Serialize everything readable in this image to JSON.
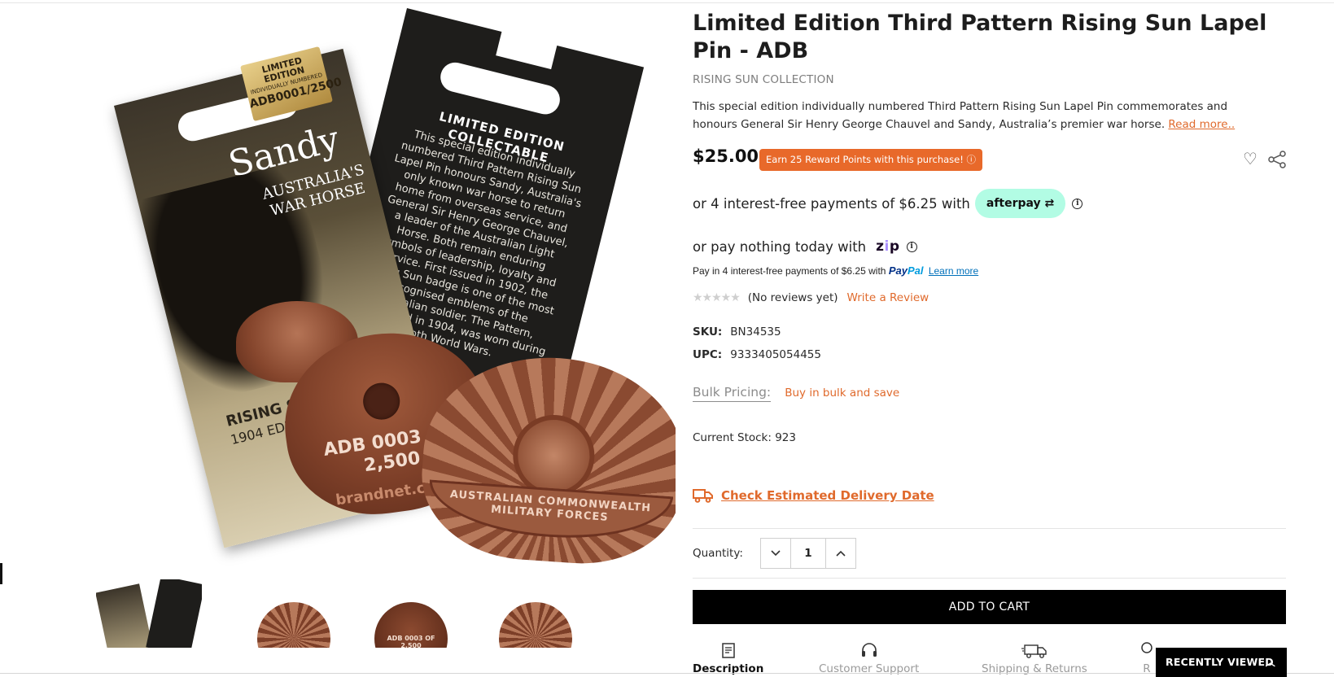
{
  "product": {
    "title": "Limited Edition Third Pattern Rising Sun Lapel Pin - ADB",
    "collection": "RISING SUN COLLECTION",
    "description": "This special edition individually numbered Third Pattern Rising Sun Lapel Pin commemorates and honours General Sir Henry George Chauvel and Sandy, Australia’s premier war horse.",
    "read_more": "Read more..",
    "price": "$25.00",
    "reward_badge": "Earn 25 Reward Points with this purchase! ⓘ"
  },
  "image": {
    "gold_tag": {
      "line1": "LIMITED EDITION",
      "line2": "INDIVIDUALLY NUMBERED",
      "line3": "ADB0001/2500"
    },
    "front_card": {
      "name": "Sandy",
      "subtitle": "AUSTRALIA'S WAR HORSE",
      "series": "RISING SU",
      "edition": "1904 EDITIO"
    },
    "back_card": {
      "heading": "LIMITED EDITION COLLECTABLE",
      "text": "This special edition individually numbered Third Pattern Rising Sun Lapel Pin honours Sandy, Australia's only known war horse to return home from overseas service, and General Sir Henry George Chauvel, a leader of the Australian Light Horse. Both remain enduring symbols of leadership, loyalty and service. First issued in 1902, the Rising Sun badge is one of the most recognised emblems of the Australian soldier. The Pattern, introduced in 1904, was worn during both World Wars."
    },
    "pin_back": {
      "engraving": "ADB 0003 OF 2,500",
      "brand": "brandnet.com"
    },
    "pin_front": {
      "scroll": "AUSTRALIAN COMMONWEALTH MILITARY FORCES"
    },
    "thumb_label": "ADB 0003 OF 2,500"
  },
  "payments": {
    "afterpay_text": "or 4 interest-free payments of $6.25 with",
    "afterpay_brand": "afterpay",
    "zip_text": "or pay nothing today with",
    "zip_brand_a": "z",
    "zip_brand_b": "i",
    "zip_brand_c": "p",
    "paypal_text": "Pay in 4 interest-free payments of $6.25 with",
    "paypal_brand_a": "Pay",
    "paypal_brand_b": "Pal",
    "paypal_learn": "Learn more"
  },
  "reviews": {
    "stars": "★★★★★",
    "status": "(No reviews yet)",
    "write": "Write a Review"
  },
  "specs": {
    "sku_label": "SKU:",
    "sku": "BN34535",
    "upc_label": "UPC:",
    "upc": "9333405054455"
  },
  "bulk": {
    "label": "Bulk Pricing:",
    "link": "Buy in bulk and save"
  },
  "stock": "Current Stock: 923",
  "delivery": "Check Estimated Delivery Date",
  "quantity": {
    "label": "Quantity:",
    "value": "1"
  },
  "add_to_cart": "ADD TO CART",
  "tabs": [
    {
      "label": "Description"
    },
    {
      "label": "Customer Support"
    },
    {
      "label": "Shipping & Returns"
    },
    {
      "label": "R"
    }
  ],
  "recently_viewed": "RECENTLY VIEWED",
  "colors": {
    "accent": "#e06a2c",
    "reward": "#e8692a",
    "afterpay": "#b2fce4",
    "cart": "#000000"
  }
}
